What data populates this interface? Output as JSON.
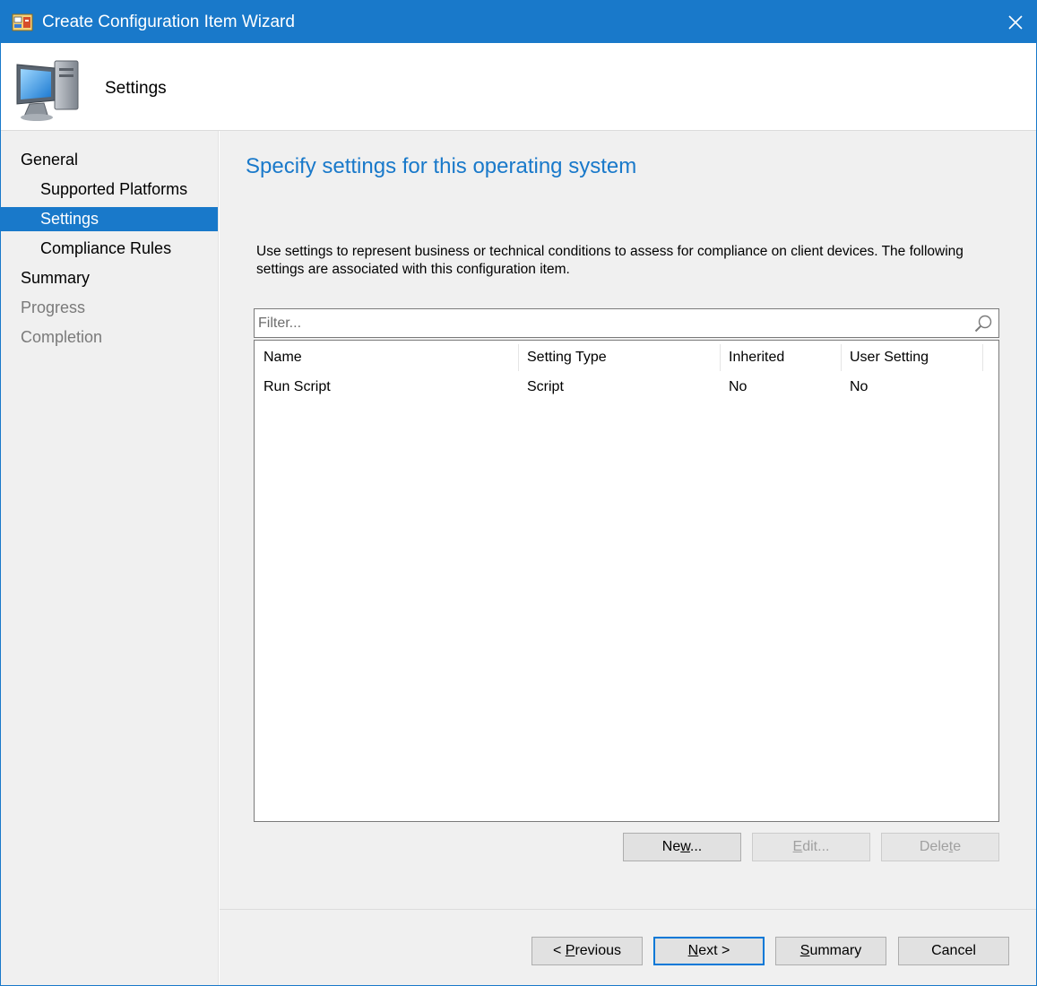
{
  "window": {
    "title": "Create Configuration Item Wizard",
    "accent_color": "#1979ca"
  },
  "header": {
    "title": "Settings",
    "icon": "computer-monitor-icon"
  },
  "nav": {
    "items": [
      {
        "label": "General",
        "level": 1,
        "state": "normal"
      },
      {
        "label": "Supported Platforms",
        "level": 2,
        "state": "normal"
      },
      {
        "label": "Settings",
        "level": 2,
        "state": "selected"
      },
      {
        "label": "Compliance Rules",
        "level": 2,
        "state": "normal"
      },
      {
        "label": "Summary",
        "level": 1,
        "state": "normal"
      },
      {
        "label": "Progress",
        "level": 1,
        "state": "disabled"
      },
      {
        "label": "Completion",
        "level": 1,
        "state": "disabled"
      }
    ]
  },
  "content": {
    "heading": "Specify settings for this operating system",
    "description": "Use settings to represent business or technical conditions to assess for compliance on client devices. The following settings are associated with this configuration item.",
    "filter": {
      "placeholder": "Filter...",
      "value": ""
    },
    "grid": {
      "columns": [
        "Name",
        "Setting Type",
        "Inherited",
        "User Setting"
      ],
      "rows": [
        [
          "Run Script",
          "Script",
          "No",
          "No"
        ]
      ]
    },
    "buttons": {
      "new": {
        "pre": "Ne",
        "accel": "w",
        "post": "...",
        "enabled": true
      },
      "edit": {
        "pre": "",
        "accel": "E",
        "post": "dit...",
        "enabled": false
      },
      "delete": {
        "pre": "Dele",
        "accel": "t",
        "post": "e",
        "enabled": false
      }
    }
  },
  "footer": {
    "previous": {
      "pre": "< ",
      "accel": "P",
      "post": "revious"
    },
    "next": {
      "pre": "",
      "accel": "N",
      "post": "ext >"
    },
    "summary": {
      "pre": "",
      "accel": "S",
      "post": "ummary"
    },
    "cancel": {
      "label": "Cancel"
    }
  }
}
